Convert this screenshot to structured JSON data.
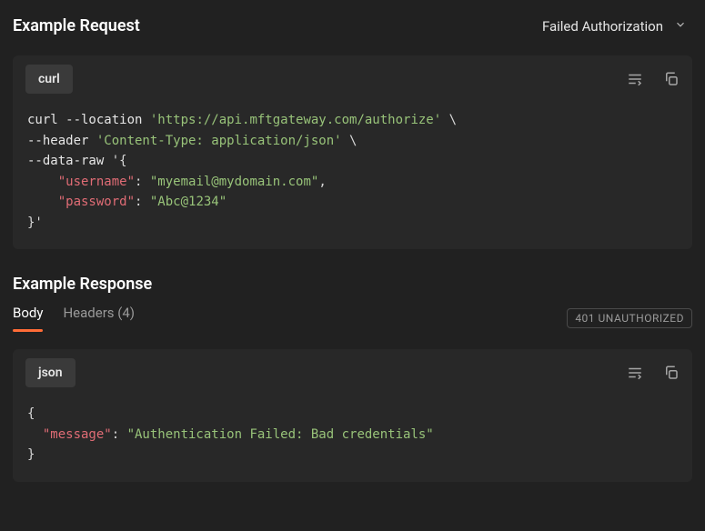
{
  "request": {
    "title": "Example Request",
    "dropdown_label": "Failed Authorization",
    "lang_badge": "curl",
    "code": {
      "line1": {
        "cmd": "curl",
        "flag": " --location ",
        "str": "'https://api.mftgateway.com/authorize'",
        "end": " \\"
      },
      "line2": {
        "flag": "--header ",
        "str": "'Content-Type: application/json'",
        "end": " \\"
      },
      "line3": {
        "flag": "--data-raw ",
        "brace_open": "'{"
      },
      "line4": {
        "indent": "    ",
        "key": "\"username\"",
        "colon": ": ",
        "val": "\"myemail@mydomain.com\"",
        "comma": ","
      },
      "line5": {
        "indent": "    ",
        "key": "\"password\"",
        "colon": ": ",
        "val": "\"Abc@1234\""
      },
      "line6": {
        "brace_close": "}'"
      }
    }
  },
  "response": {
    "title": "Example Response",
    "tabs": {
      "body": "Body",
      "headers": "Headers (4)"
    },
    "status": "401 UNAUTHORIZED",
    "lang_badge": "json",
    "code": {
      "line1": {
        "brace": "{"
      },
      "line2": {
        "indent": "  ",
        "key": "\"message\"",
        "colon": ": ",
        "val": "\"Authentication Failed: Bad credentials\""
      },
      "line3": {
        "brace": "}"
      }
    }
  }
}
